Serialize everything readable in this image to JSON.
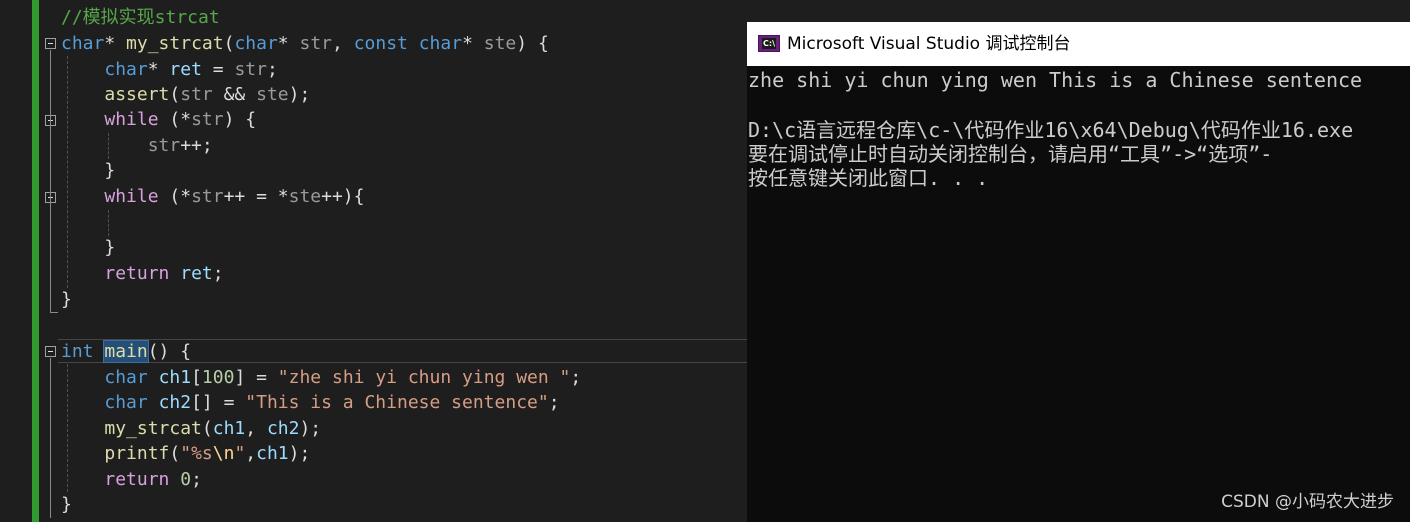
{
  "editor": {
    "lines": [
      [
        [
          "cm",
          "//模拟实现strcat"
        ]
      ],
      [
        [
          "k",
          "char"
        ],
        [
          "",
          "* "
        ],
        [
          "f",
          "my_strcat"
        ],
        [
          "",
          "("
        ],
        [
          "k",
          "char"
        ],
        [
          "",
          "* "
        ],
        [
          "p",
          "str"
        ],
        [
          "",
          ", "
        ],
        [
          "k",
          "const char"
        ],
        [
          "",
          "* "
        ],
        [
          "p",
          "ste"
        ],
        [
          "",
          ") {"
        ]
      ],
      [
        [
          "",
          "    "
        ],
        [
          "k",
          "char"
        ],
        [
          "",
          "* "
        ],
        [
          "v",
          "ret"
        ],
        [
          "",
          " = "
        ],
        [
          "p",
          "str"
        ],
        [
          "",
          ";"
        ]
      ],
      [
        [
          "",
          "    "
        ],
        [
          "f",
          "assert"
        ],
        [
          "",
          "("
        ],
        [
          "p",
          "str"
        ],
        [
          "",
          " && "
        ],
        [
          "p",
          "ste"
        ],
        [
          "",
          ");"
        ]
      ],
      [
        [
          "",
          "    "
        ],
        [
          "c",
          "while"
        ],
        [
          "",
          " (*"
        ],
        [
          "p",
          "str"
        ],
        [
          "",
          ") {"
        ]
      ],
      [
        [
          "",
          "        "
        ],
        [
          "p",
          "str"
        ],
        [
          "",
          "++;"
        ]
      ],
      [
        [
          "",
          "    }"
        ]
      ],
      [
        [
          "",
          "    "
        ],
        [
          "c",
          "while"
        ],
        [
          "",
          " (*"
        ],
        [
          "p",
          "str"
        ],
        [
          "",
          "++ = *"
        ],
        [
          "p",
          "ste"
        ],
        [
          "",
          "++){"
        ]
      ],
      [
        [
          "",
          ""
        ]
      ],
      [
        [
          "",
          "    }"
        ]
      ],
      [
        [
          "",
          "    "
        ],
        [
          "c",
          "return"
        ],
        [
          "",
          " "
        ],
        [
          "v",
          "ret"
        ],
        [
          "",
          ";"
        ]
      ],
      [
        [
          "",
          "}"
        ]
      ],
      [
        [
          "",
          ""
        ]
      ],
      [
        [
          "k",
          "int"
        ],
        [
          "",
          " "
        ],
        [
          "sel",
          "main"
        ],
        [
          "",
          "() {"
        ]
      ],
      [
        [
          "",
          "    "
        ],
        [
          "k",
          "char"
        ],
        [
          "",
          " "
        ],
        [
          "v",
          "ch1"
        ],
        [
          "",
          "["
        ],
        [
          "n",
          "100"
        ],
        [
          "",
          "] = "
        ],
        [
          "s",
          "\"zhe shi yi chun ying wen \""
        ],
        [
          "",
          ";"
        ]
      ],
      [
        [
          "",
          "    "
        ],
        [
          "k",
          "char"
        ],
        [
          "",
          " "
        ],
        [
          "v",
          "ch2"
        ],
        [
          "",
          "[] = "
        ],
        [
          "s",
          "\"This is a Chinese sentence\""
        ],
        [
          "",
          ";"
        ]
      ],
      [
        [
          "",
          "    "
        ],
        [
          "f",
          "my_strcat"
        ],
        [
          "",
          "("
        ],
        [
          "v",
          "ch1"
        ],
        [
          "",
          ", "
        ],
        [
          "v",
          "ch2"
        ],
        [
          "",
          ");"
        ]
      ],
      [
        [
          "",
          "    "
        ],
        [
          "f",
          "printf"
        ],
        [
          "",
          "("
        ],
        [
          "s",
          "\"%s"
        ],
        [
          "e",
          "\\n"
        ],
        [
          "s",
          "\""
        ],
        [
          "",
          ","
        ],
        [
          "v",
          "ch1"
        ],
        [
          "",
          ");"
        ]
      ],
      [
        [
          "",
          "    "
        ],
        [
          "c",
          "return"
        ],
        [
          "",
          " "
        ],
        [
          "n",
          "0"
        ],
        [
          "",
          ";"
        ]
      ],
      [
        [
          "",
          "}"
        ]
      ]
    ]
  },
  "console": {
    "icon_text": "C:\\",
    "title": "Microsoft Visual Studio 调试控制台",
    "output": [
      "zhe shi yi chun ying wen This is a Chinese sentence",
      "",
      "D:\\c语言远程仓库\\c-\\代码作业16\\x64\\Debug\\代码作业16.exe",
      "要在调试停止时自动关闭控制台，请启用“工具”->“选项”-",
      "按任意键关闭此窗口. . ."
    ]
  },
  "watermark": "CSDN @小码农大进步"
}
